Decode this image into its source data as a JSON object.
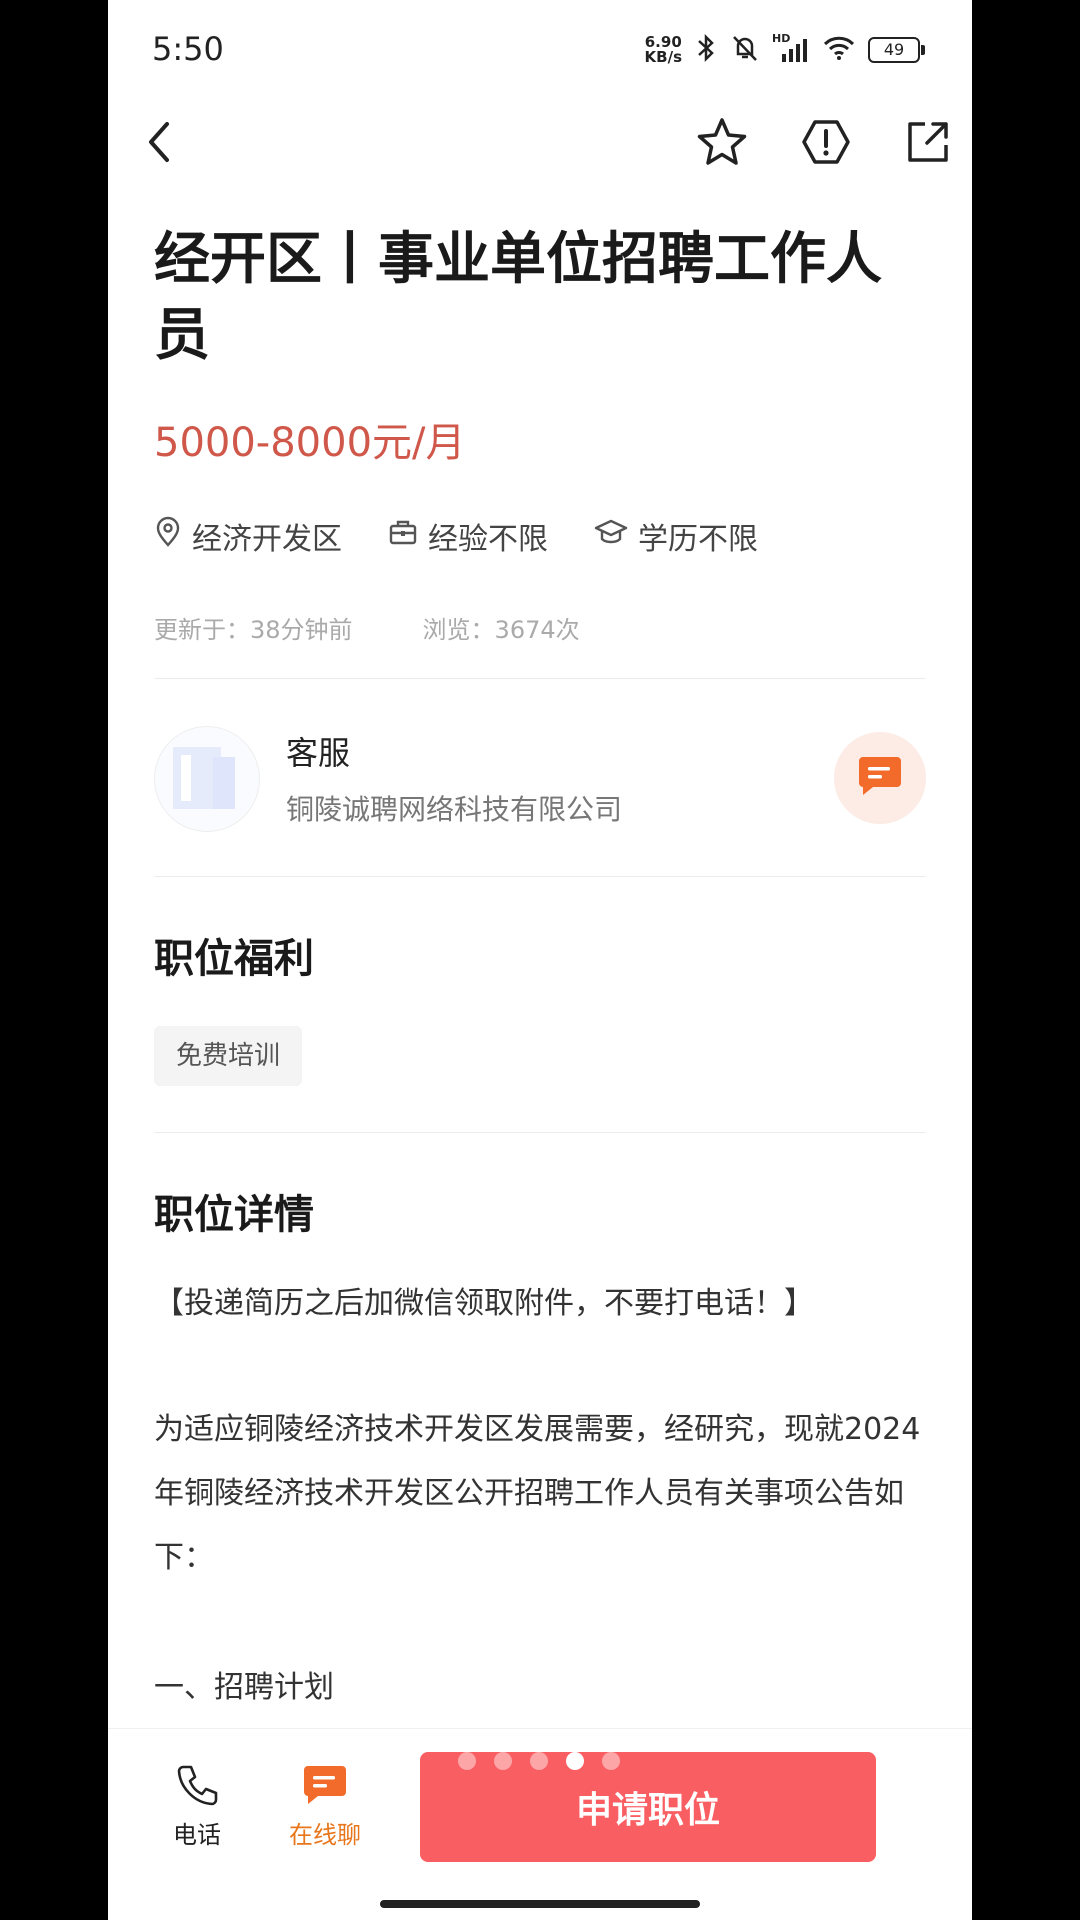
{
  "status": {
    "time": "5:50",
    "net_speed_value": "6.90",
    "net_speed_unit": "KB/s",
    "signal_label": "HD",
    "battery": "49",
    "icons": [
      "bluetooth-icon",
      "mute-bell-icon",
      "signal-icon",
      "wifi-icon",
      "battery-icon"
    ]
  },
  "nav": {
    "icons": [
      "back-arrow-icon",
      "star-icon",
      "report-icon",
      "share-icon"
    ]
  },
  "job": {
    "title": "经开区丨事业单位招聘工作人员",
    "salary": "5000-8000元/月",
    "location": "经济开发区",
    "experience": "经验不限",
    "education": "学历不限",
    "updated": "更新于：38分钟前",
    "views": "浏览：3674次"
  },
  "recruiter": {
    "name": "客服",
    "company": "铜陵诚聘网络科技有限公司"
  },
  "benefits": {
    "title": "职位福利",
    "items": [
      "免费培训"
    ]
  },
  "details": {
    "title": "职位详情",
    "paragraphs": [
      "【投递简历之后加微信领取附件，不要打电话！】",
      "为适应铜陵经济技术开发区发展需要，经研究，现就2024年铜陵经济技术开发区公开招聘工作人员有关事项公告如下：",
      "一、招聘计划"
    ]
  },
  "bottom": {
    "phone_label": "电话",
    "chat_label": "在线聊",
    "apply_label": "申请职位",
    "page_dots": {
      "count": 5,
      "active_index": 3
    }
  },
  "colors": {
    "salary": "#d0584a",
    "apply_button": "#f95e62",
    "accent_orange": "#f26b2a"
  }
}
